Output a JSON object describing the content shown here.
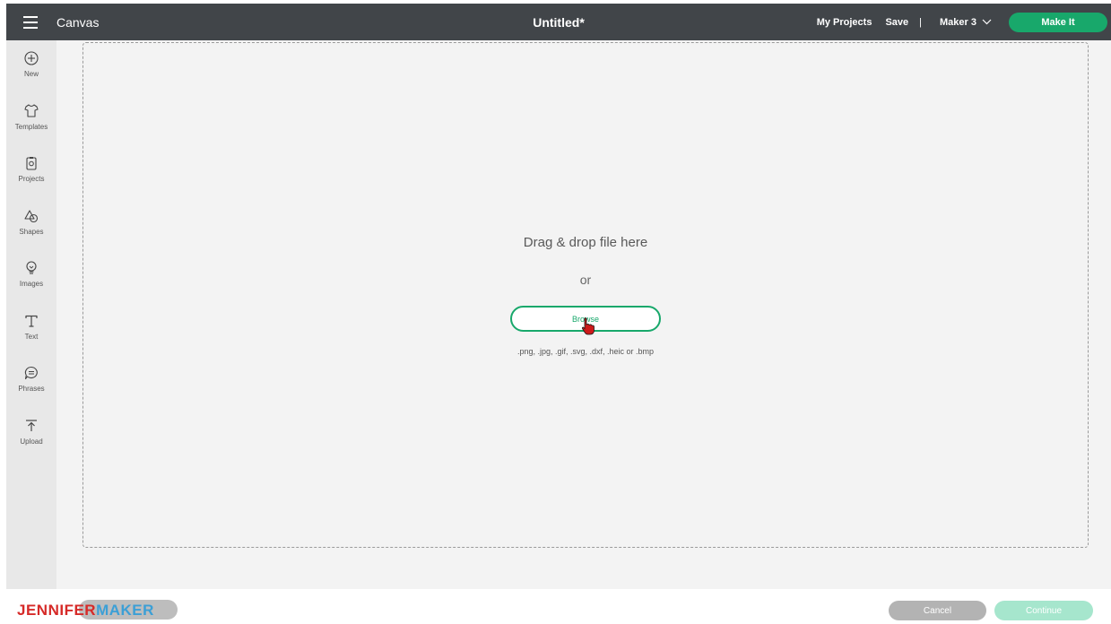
{
  "topbar": {
    "app_name": "Canvas",
    "doc_title": "Untitled*",
    "my_projects": "My Projects",
    "save": "Save",
    "separator": "|",
    "machine": "Maker 3",
    "make_it": "Make It"
  },
  "sidebar": {
    "items": [
      {
        "label": "New",
        "icon": "plus-circle-icon"
      },
      {
        "label": "Templates",
        "icon": "tshirt-icon"
      },
      {
        "label": "Projects",
        "icon": "projects-icon"
      },
      {
        "label": "Shapes",
        "icon": "shapes-icon"
      },
      {
        "label": "Images",
        "icon": "lightbulb-icon"
      },
      {
        "label": "Text",
        "icon": "text-icon"
      },
      {
        "label": "Phrases",
        "icon": "chat-bubble-icon"
      },
      {
        "label": "Upload",
        "icon": "upload-icon"
      }
    ]
  },
  "upload": {
    "drag_text": "Drag & drop file here",
    "or_text": "or",
    "browse": "Browse",
    "formats": ".png, .jpg, .gif, .svg, .dxf, .heic or .bmp"
  },
  "footer": {
    "cancel": "Cancel",
    "continue": "Continue",
    "logo_part1": "JENNIFER",
    "logo_part2": "MAKER"
  },
  "colors": {
    "accent": "#18a86b",
    "topbar": "#414549",
    "continue_disabled": "#a6e6cd",
    "cancel": "#b3b3b3"
  }
}
